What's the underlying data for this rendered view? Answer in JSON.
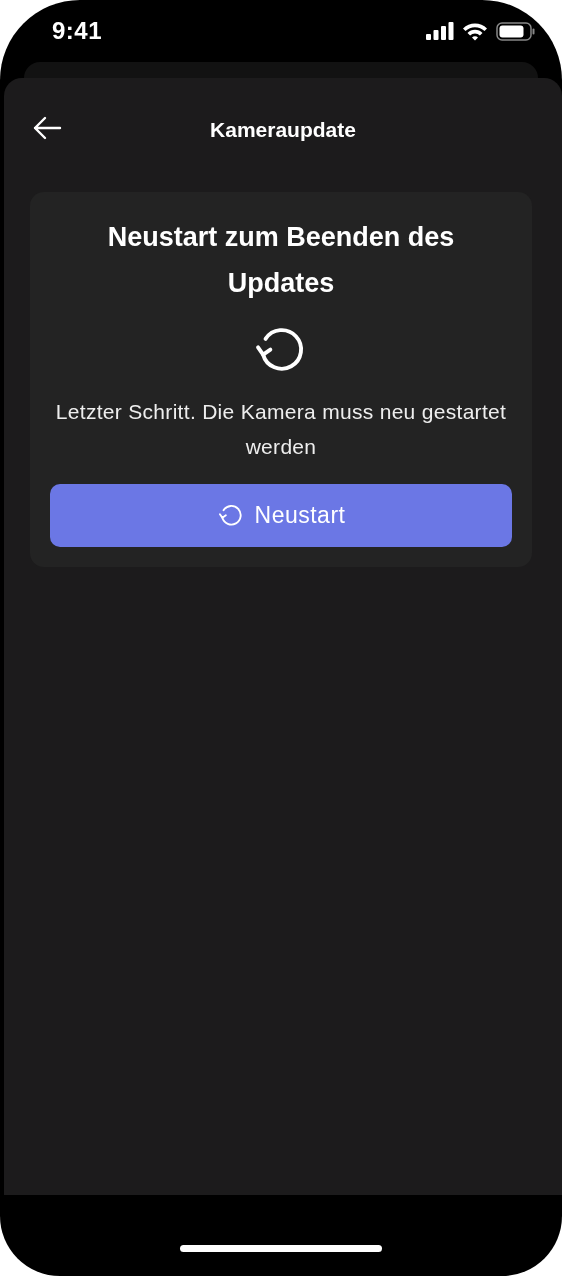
{
  "status_bar": {
    "time": "9:41"
  },
  "header": {
    "title": "Kameraupdate"
  },
  "card": {
    "title": "Neustart zum Beenden des Updates",
    "message": "Letzter Schritt. Die Kamera muss neu gestartet werden",
    "button": "Neustart"
  }
}
